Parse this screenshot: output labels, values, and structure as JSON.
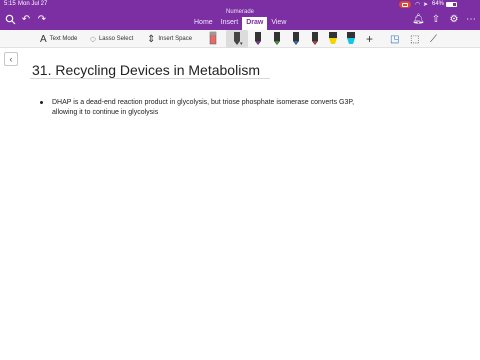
{
  "status_bar": {
    "time": "5:15",
    "date": "Mon Jul 27",
    "battery": "64%",
    "wifi_icon": "wifi-icon",
    "location_icon": "location-icon"
  },
  "app": {
    "title": "Numerade"
  },
  "tabs": [
    {
      "label": "Home",
      "active": false
    },
    {
      "label": "Insert",
      "active": false
    },
    {
      "label": "Draw",
      "active": true
    },
    {
      "label": "View",
      "active": false
    }
  ],
  "ribbon": {
    "text_mode": "Text Mode",
    "lasso_select": "Lasso Select",
    "insert_space": "Insert Space",
    "pen_colors": [
      "#e46b6b",
      "#444444",
      "#5a2d82",
      "#3b7a3b",
      "#2f6dbf",
      "#b23b3b",
      "#f2d400",
      "#15c7e6"
    ]
  },
  "page": {
    "title": "31. Recycling Devices in Metabolism",
    "bullet_line1": "DHAP is a dead-end reaction product in glycolysis, but triose phosphate isomerase converts G3P,",
    "bullet_line2": "allowing it to continue in glycolysis"
  }
}
